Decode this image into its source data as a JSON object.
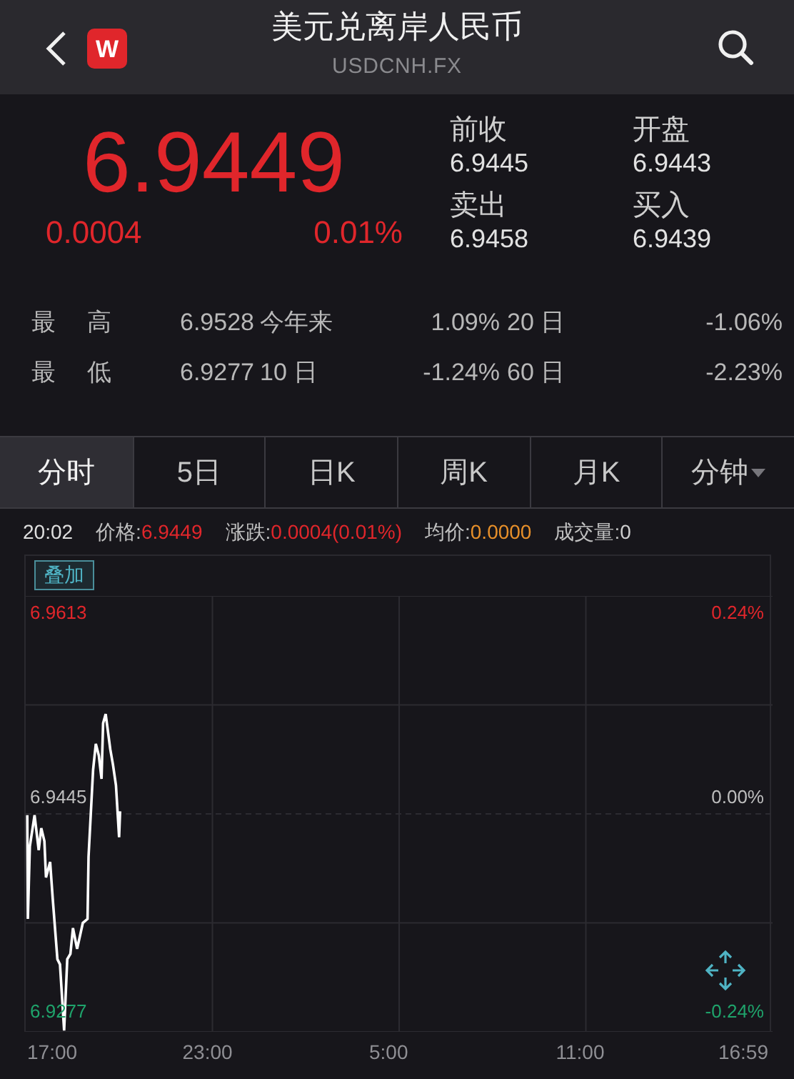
{
  "header": {
    "title": "美元兑离岸人民币",
    "subtitle": "USDCNH.FX",
    "logo": "W"
  },
  "quote": {
    "price": "6.9449",
    "change": "0.0004",
    "change_pct": "0.01%",
    "fields": [
      {
        "label": "前收",
        "value": "6.9445"
      },
      {
        "label": "开盘",
        "value": "6.9443"
      },
      {
        "label": "卖出",
        "value": "6.9458"
      },
      {
        "label": "买入",
        "value": "6.9439"
      }
    ]
  },
  "stats": [
    [
      {
        "label": "最高",
        "value": "6.9528"
      },
      {
        "label": "今年来",
        "value": "1.09%"
      },
      {
        "label": "20 日",
        "value": "-1.06%"
      }
    ],
    [
      {
        "label": "最低",
        "value": "6.9277"
      },
      {
        "label": "10 日",
        "value": "-1.24%"
      },
      {
        "label": "60 日",
        "value": "-2.23%"
      }
    ]
  ],
  "tabs": [
    {
      "label": "分时",
      "selected": true,
      "dropdown": false
    },
    {
      "label": "5日",
      "selected": false,
      "dropdown": false
    },
    {
      "label": "日K",
      "selected": false,
      "dropdown": false
    },
    {
      "label": "周K",
      "selected": false,
      "dropdown": false
    },
    {
      "label": "月K",
      "selected": false,
      "dropdown": false
    },
    {
      "label": "分钟",
      "selected": false,
      "dropdown": true
    }
  ],
  "info": {
    "time": "20:02",
    "items": [
      {
        "label": "价格:",
        "value": "6.9449",
        "color": "#e0262b"
      },
      {
        "label": "涨跌:",
        "value": "0.0004(0.01%)",
        "color": "#e0262b"
      },
      {
        "label": "均价:",
        "value": "0.0000",
        "color": "#e8902a"
      },
      {
        "label": "成交量:",
        "value": "0",
        "color": "#cfcfcf"
      }
    ]
  },
  "overlay_button": "叠加",
  "chart": {
    "levels": [
      {
        "price": "6.9613",
        "percent": "0.24%",
        "kind": "up"
      },
      {
        "price": "6.9445",
        "percent": "0.00%",
        "kind": "flat"
      },
      {
        "price": "6.9277",
        "percent": "-0.24%",
        "kind": "down"
      }
    ],
    "time_axis": [
      "17:00",
      "23:00",
      "5:00",
      "11:00",
      "16:59"
    ]
  }
}
